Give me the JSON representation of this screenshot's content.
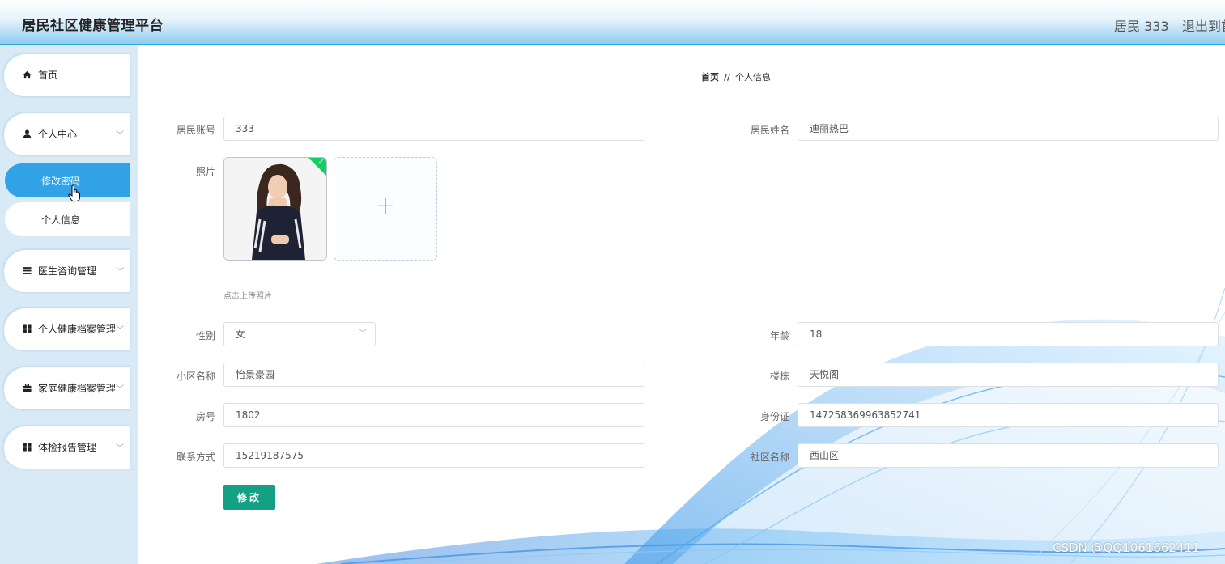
{
  "header": {
    "title": "居民社区健康管理平台",
    "user": "居民 333",
    "logout": "退出到首页"
  },
  "sidebar": {
    "items": [
      {
        "label": "首页",
        "icon": "home-icon"
      },
      {
        "label": "个人中心",
        "icon": "user-icon"
      },
      {
        "label": "医生咨询管理",
        "icon": "list-icon"
      },
      {
        "label": "个人健康档案管理",
        "icon": "grid-icon"
      },
      {
        "label": "家庭健康档案管理",
        "icon": "briefcase-icon"
      },
      {
        "label": "体检报告管理",
        "icon": "grid-icon"
      }
    ],
    "submenu": [
      {
        "label": "修改密码"
      },
      {
        "label": "个人信息"
      }
    ]
  },
  "breadcrumb": {
    "home": "首页",
    "separator": "//",
    "current": "个人信息"
  },
  "form": {
    "account_label": "居民账号",
    "account_value": "333",
    "name_label": "居民姓名",
    "name_value": "迪丽热巴",
    "photo_label": "照片",
    "upload_tip": "点击上传照片",
    "upload_plus": "+",
    "gender_label": "性别",
    "gender_value": "女",
    "age_label": "年龄",
    "age_value": "18",
    "community_label": "小区名称",
    "community_value": "怡景豪园",
    "building_label": "楼栋",
    "building_value": "天悦阁",
    "room_label": "房号",
    "room_value": "1802",
    "idcard_label": "身份证",
    "idcard_value": "147258369963852741",
    "phone_label": "联系方式",
    "phone_value": "15219187575",
    "district_label": "社区名称",
    "district_value": "西山区",
    "submit_label": "修改"
  },
  "watermark": "CSDN @QQ1061662411",
  "colors": {
    "accent": "#31a2e6",
    "submit": "#13a085",
    "upload_success": "#13ce66"
  }
}
